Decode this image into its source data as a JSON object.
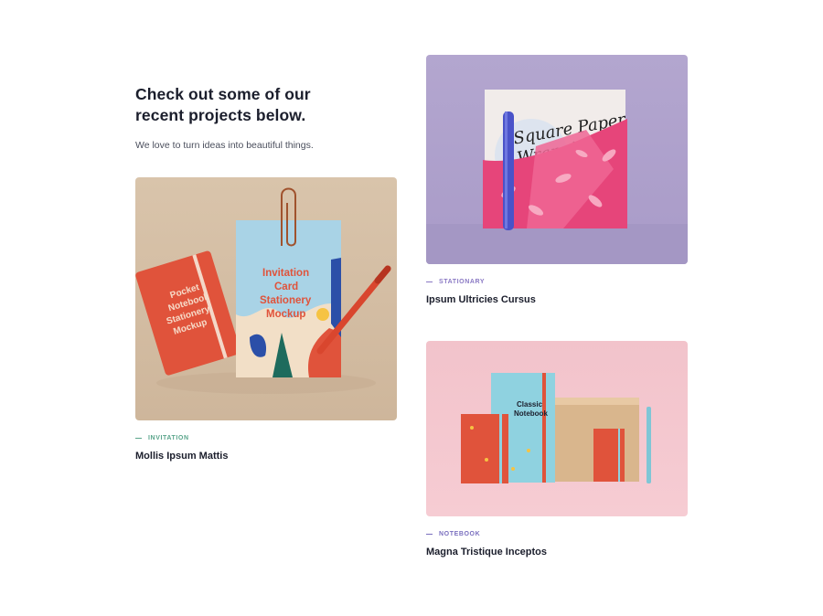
{
  "intro": {
    "heading_line1": "Check out some of our",
    "heading_line2": "recent projects below.",
    "subtext": "We love to turn ideas into beautiful things."
  },
  "projects": [
    {
      "category": "INVITATION",
      "title": "Mollis Ipsum Mattis",
      "category_color": "#5aa58b",
      "image_text": {
        "pocket_book": [
          "Pocket",
          "Notebook",
          "Stationery",
          "Mockup"
        ],
        "card_title": [
          "Invitation",
          "Card",
          "Stationery",
          "Mockup"
        ]
      }
    },
    {
      "category": "STATIONARY",
      "title": "Ipsum Ultricies Cursus",
      "category_color": "#8a79c4",
      "image_text": {
        "paper_script": [
          "Square Paper",
          "Wrapping"
        ]
      }
    },
    {
      "category": "NOTEBOOK",
      "title": "Magna Tristique Inceptos",
      "category_color": "#7a6fbf",
      "image_text": {
        "notebook_label": [
          "Classic",
          "Notebook"
        ]
      }
    }
  ]
}
